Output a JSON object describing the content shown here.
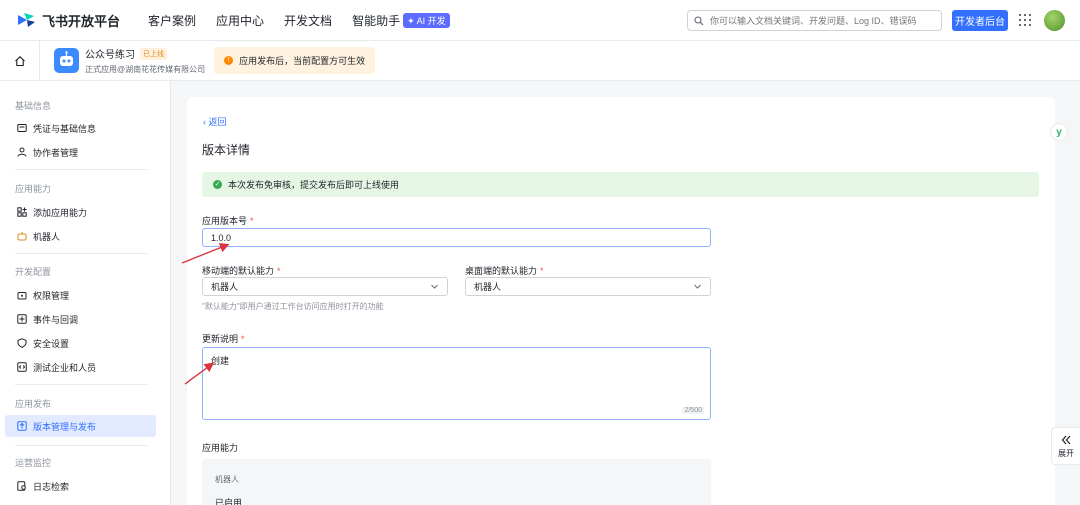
{
  "topnav": {
    "logo_text": "飞书开放平台",
    "nav": [
      {
        "label": "客户案例"
      },
      {
        "label": "应用中心"
      },
      {
        "label": "开发文档"
      },
      {
        "label": "智能助手",
        "badge": "AI 开发"
      }
    ],
    "search_placeholder": "你可以输入文档关键词、开发问题、Log ID、错误码",
    "dev_button": "开发者后台"
  },
  "subhead": {
    "app_name": "公众号练习",
    "status_tag": "已上线",
    "app_org": "正式应用@湖南花花传媒有限公司",
    "notice": "应用发布后，当前配置方可生效"
  },
  "sidebar": {
    "sections": [
      {
        "title": "基础信息",
        "items": [
          {
            "label": "凭证与基础信息"
          },
          {
            "label": "协作者管理"
          }
        ]
      },
      {
        "title": "应用能力",
        "items": [
          {
            "label": "添加应用能力"
          },
          {
            "label": "机器人"
          }
        ]
      },
      {
        "title": "开发配置",
        "items": [
          {
            "label": "权限管理"
          },
          {
            "label": "事件与回调"
          },
          {
            "label": "安全设置"
          },
          {
            "label": "测试企业和人员"
          }
        ]
      },
      {
        "title": "应用发布",
        "items": [
          {
            "label": "版本管理与发布"
          }
        ]
      },
      {
        "title": "运营监控",
        "items": [
          {
            "label": "日志检索"
          }
        ]
      }
    ]
  },
  "main": {
    "back": "返回",
    "title": "版本详情",
    "success_notice": "本次发布免审核，提交发布后即可上线使用",
    "version_label": "应用版本号",
    "version_value": "1.0.0",
    "mobile_label": "移动端的默认能力",
    "mobile_value": "机器人",
    "desktop_label": "桌面端的默认能力",
    "desktop_value": "机器人",
    "default_hint": "\"默认能力\"即用户通过工作台访问应用时打开的功能",
    "notes_label": "更新说明",
    "notes_value": "创建",
    "notes_counter": "2/500",
    "capability_label": "应用能力",
    "capability_name": "机器人",
    "capability_status": "已启用",
    "required_mark": "*"
  },
  "right": {
    "expand_label": "展开"
  },
  "colors": {
    "accent": "#3370ff",
    "success_bg": "#e5f6e5",
    "notice_bg": "#fff3e0",
    "annotation_arrow": "#d9363e"
  }
}
